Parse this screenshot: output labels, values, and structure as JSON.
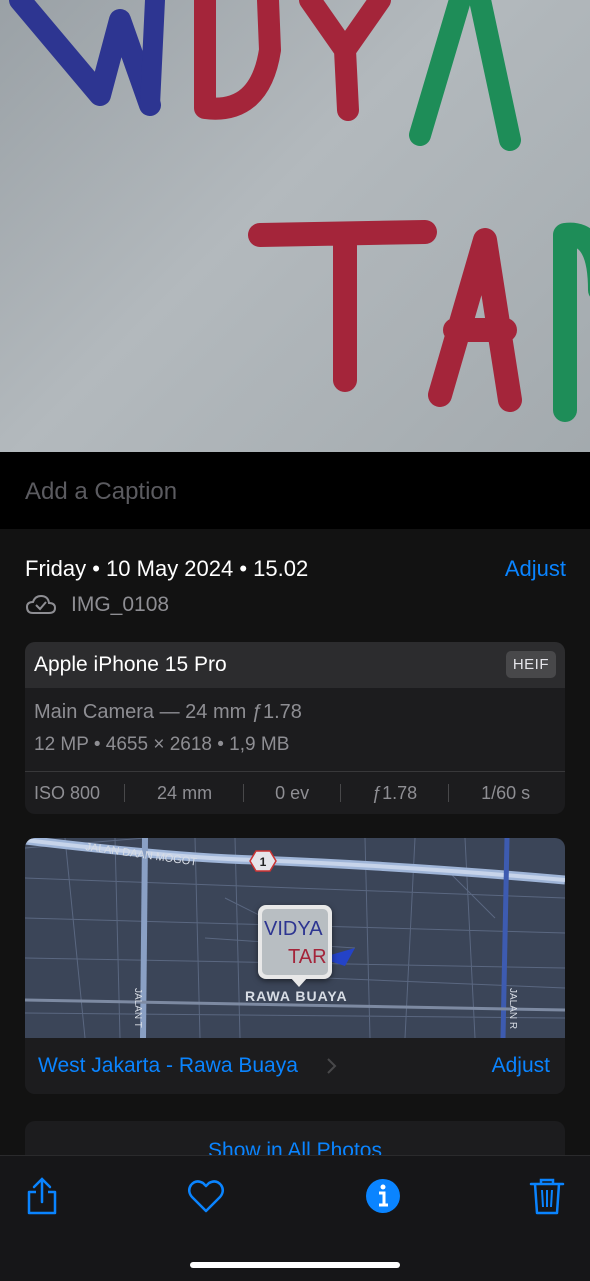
{
  "photo": {
    "description_icon": "photo-viewer"
  },
  "caption": {
    "placeholder": "Add a Caption"
  },
  "info": {
    "date": "Friday • 10 May 2024 • 15.02",
    "adjust_label": "Adjust",
    "filename": "IMG_0108",
    "device": "Apple iPhone 15 Pro",
    "format_badge": "HEIF",
    "lens": "Main Camera — 24 mm ƒ1.78",
    "specs": "12 MP  •  4655 × 2618  •  1,9 MB",
    "exif": {
      "iso": "ISO 800",
      "focal": "24 mm",
      "ev": "0 ev",
      "aperture": "ƒ1.78",
      "shutter": "1/60 s"
    }
  },
  "map": {
    "road_label": "JALAN DAAN MOGOT",
    "route_number": "1",
    "area_label": "RAWA BUAYA",
    "side_road_left": "JALAN T",
    "side_road_right": "JALAN R",
    "pin_text_1": "VIDYA",
    "pin_text_2": "TAR",
    "location": "West Jakarta - Rawa Buaya",
    "adjust_label": "Adjust"
  },
  "show_all": "Show in All Photos",
  "photo_text": {
    "line1": "VIDYA",
    "line2": "TAR"
  },
  "colors": {
    "accent": "#0a84ff",
    "sheet": "#121212",
    "card": "#1c1c1e"
  },
  "toolbar": {
    "icons": [
      "share-icon",
      "heart-icon",
      "info-icon",
      "trash-icon"
    ]
  }
}
